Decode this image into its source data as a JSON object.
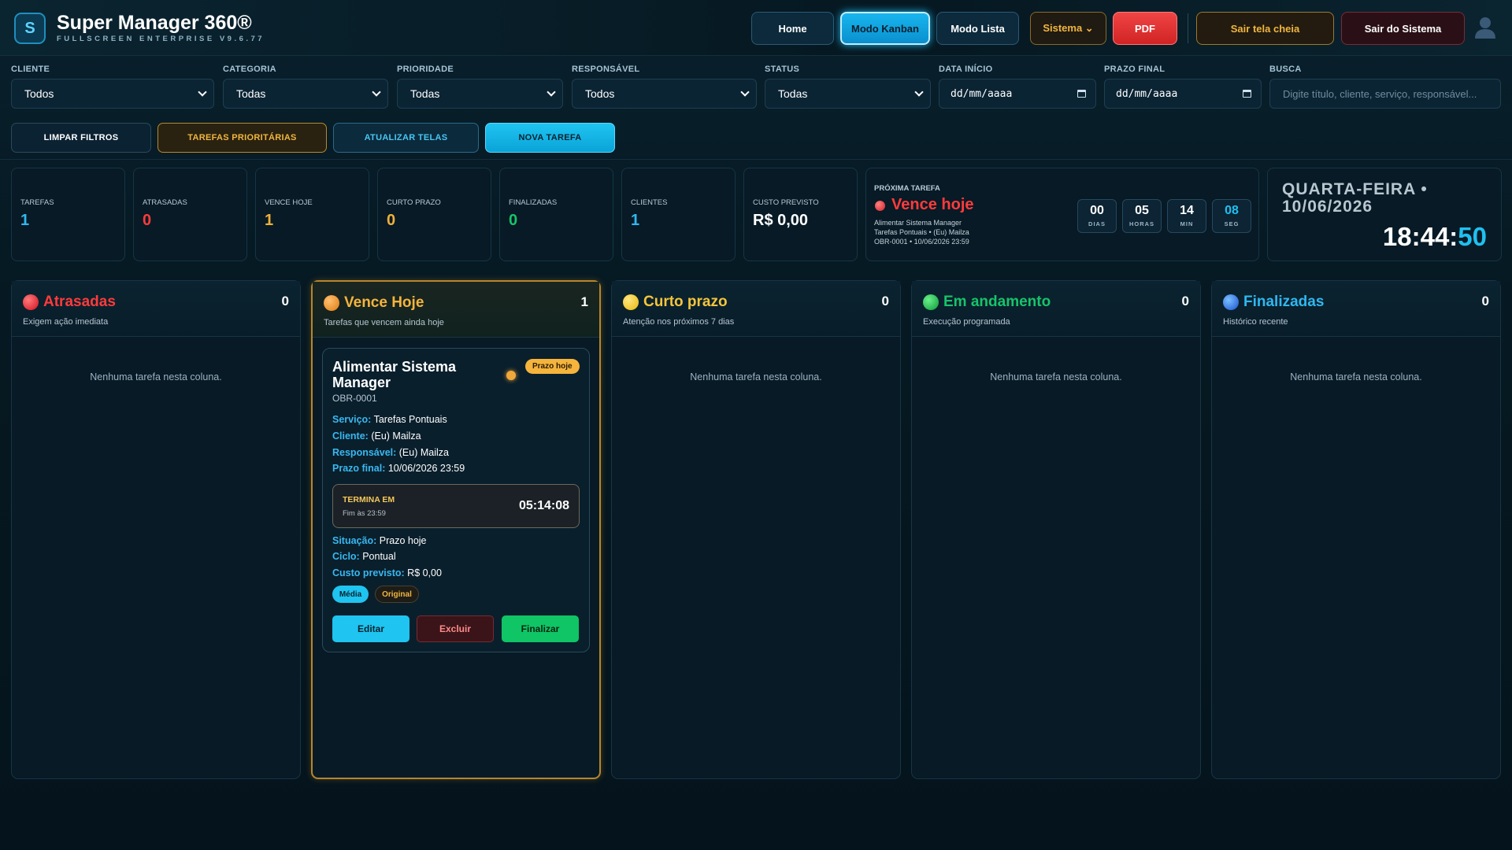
{
  "app": {
    "logo_letter": "S",
    "title": "Super Manager 360®",
    "subtitle": "FULLSCREEN ENTERPRISE V9.6.77"
  },
  "nav": {
    "home": "Home",
    "kanban": "Modo Kanban",
    "lista": "Modo Lista",
    "sistema": "Sistema ⌄",
    "pdf": "PDF",
    "sair_tela": "Sair tela cheia",
    "sair_sistema": "Sair do Sistema"
  },
  "filters": {
    "cliente": {
      "label": "CLIENTE",
      "value": "Todos"
    },
    "categoria": {
      "label": "CATEGORIA",
      "value": "Todas"
    },
    "prioridade": {
      "label": "PRIORIDADE",
      "value": "Todas"
    },
    "responsavel": {
      "label": "RESPONSÁVEL",
      "value": "Todos"
    },
    "status": {
      "label": "STATUS",
      "value": "Todas"
    },
    "data_inicio": {
      "label": "DATA INÍCIO",
      "value": "dd/mm/aaaa"
    },
    "prazo_final": {
      "label": "PRAZO FINAL",
      "value": "dd/mm/aaaa"
    },
    "busca": {
      "label": "BUSCA",
      "placeholder": "Digite título, cliente, serviço, responsável..."
    }
  },
  "actions": {
    "limpar": "LIMPAR FILTROS",
    "prioritarias": "TAREFAS PRIORITÁRIAS",
    "atualizar": "ATUALIZAR TELAS",
    "nova": "NOVA TAREFA"
  },
  "stats": [
    {
      "label": "TAREFAS",
      "value": "1",
      "color": "#2fb8f0"
    },
    {
      "label": "ATRASADAS",
      "value": "0",
      "color": "#ff3b3b"
    },
    {
      "label": "VENCE HOJE",
      "value": "1",
      "color": "#f0b03a"
    },
    {
      "label": "CURTO PRAZO",
      "value": "0",
      "color": "#f0b03a"
    },
    {
      "label": "FINALIZADAS",
      "value": "0",
      "color": "#17c46a"
    },
    {
      "label": "CLIENTES",
      "value": "1",
      "color": "#2fb8f0"
    },
    {
      "label": "CUSTO PREVISTO",
      "value": "R$ 0,00",
      "color": "#ffffff"
    }
  ],
  "next_task": {
    "label": "PRÓXIMA TAREFA",
    "status": "Vence hoje",
    "line1": "Alimentar Sistema Manager",
    "line2": "Tarefas Pontuais • (Eu) Mailza",
    "line3": "OBR-0001 • 10/06/2026 23:59",
    "countdown": [
      {
        "value": "00",
        "unit": "DIAS"
      },
      {
        "value": "05",
        "unit": "HORAS"
      },
      {
        "value": "14",
        "unit": "MIN"
      },
      {
        "value": "08",
        "unit": "SEG"
      }
    ]
  },
  "clock": {
    "date": "QUARTA-FEIRA • 10/06/2026",
    "hm": "18:44:",
    "sec": "50"
  },
  "columns": [
    {
      "title": "Atrasadas",
      "count": "0",
      "subtitle": "Exigem ação imediata",
      "color": "#ff3b3b",
      "dot": "#e01f2a",
      "empty": "Nenhuma tarefa nesta coluna."
    },
    {
      "title": "Vence Hoje",
      "count": "1",
      "subtitle": "Tarefas que vencem ainda hoje",
      "color": "#f5b43c",
      "dot": "#f08a1a",
      "empty": ""
    },
    {
      "title": "Curto prazo",
      "count": "0",
      "subtitle": "Atenção nos próximos 7 dias",
      "color": "#f5c53c",
      "dot": "#f5c51a",
      "empty": "Nenhuma tarefa nesta coluna."
    },
    {
      "title": "Em andamento",
      "count": "0",
      "subtitle": "Execução programada",
      "color": "#17c46a",
      "dot": "#12b04a",
      "empty": "Nenhuma tarefa nesta coluna."
    },
    {
      "title": "Finalizadas",
      "count": "0",
      "subtitle": "Histórico recente",
      "color": "#2fb8f0",
      "dot": "#1a6fe0",
      "empty": "Nenhuma tarefa nesta coluna."
    }
  ],
  "card": {
    "title": "Alimentar Sistema Manager",
    "badge": "Prazo hoje",
    "code": "OBR-0001",
    "servico_k": "Serviço:",
    "servico_v": "Tarefas Pontuais",
    "cliente_k": "Cliente:",
    "cliente_v": "(Eu) Mailza",
    "resp_k": "Responsável:",
    "resp_v": "(Eu) Mailza",
    "prazo_k": "Prazo final:",
    "prazo_v": "10/06/2026 23:59",
    "term_label": "TERMINA EM",
    "term_sub": "Fim às 23:59",
    "term_value": "05:14:08",
    "situacao_k": "Situação:",
    "situacao_v": "Prazo hoje",
    "ciclo_k": "Ciclo:",
    "ciclo_v": "Pontual",
    "custo_k": "Custo previsto:",
    "custo_v": "R$ 0,00",
    "tag1": "Média",
    "tag2": "Original",
    "btn_editar": "Editar",
    "btn_excluir": "Excluir",
    "btn_finalizar": "Finalizar"
  }
}
